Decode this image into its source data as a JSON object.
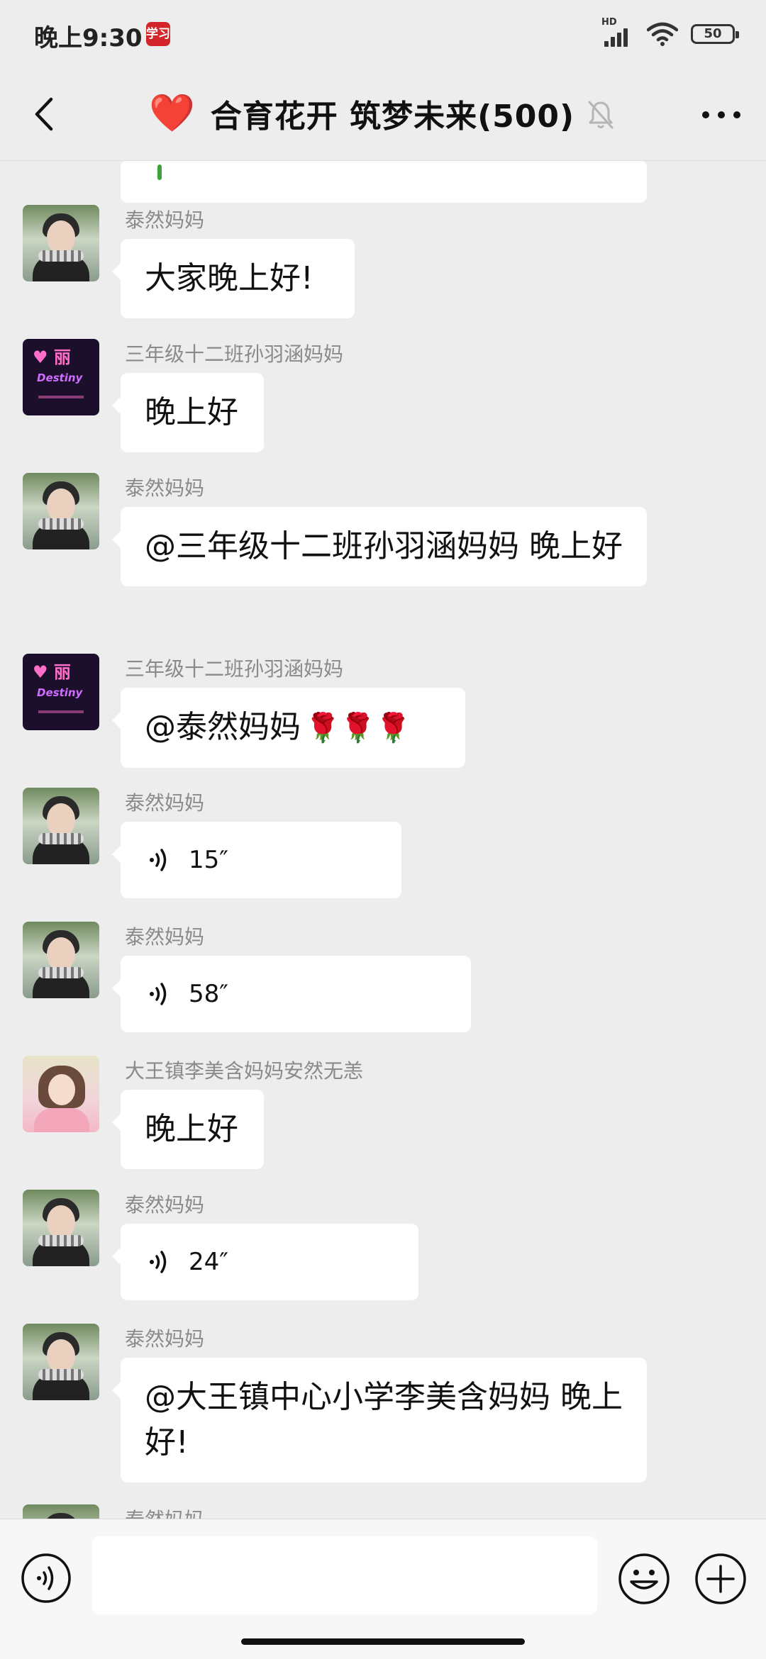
{
  "status_bar": {
    "time": "晚上9:30",
    "app_badge": "学习",
    "network": "HD",
    "battery": "50"
  },
  "header": {
    "title": "合育花开 筑梦未来(500)",
    "emoji": "❤️"
  },
  "messages": [
    {
      "sender": "泰然妈妈",
      "type": "text",
      "text": "大家晚上好!"
    },
    {
      "sender": "三年级十二班孙羽涵妈妈",
      "type": "text",
      "text": "晚上好"
    },
    {
      "sender": "泰然妈妈",
      "type": "text",
      "text": "@三年级十二班孙羽涵妈妈  晚上好"
    },
    {
      "sender": "三年级十二班孙羽涵妈妈",
      "type": "text",
      "text": "@泰然妈妈",
      "emoji": "🌹🌹🌹"
    },
    {
      "sender": "泰然妈妈",
      "type": "voice",
      "duration": "15″"
    },
    {
      "sender": "泰然妈妈",
      "type": "voice",
      "duration": "58″"
    },
    {
      "sender": "大王镇李美含妈妈安然无恙",
      "type": "text",
      "text": "晚上好"
    },
    {
      "sender": "泰然妈妈",
      "type": "voice",
      "duration": "24″"
    },
    {
      "sender": "泰然妈妈",
      "type": "text",
      "text": "@大王镇中心小学李美含妈妈  晚上好!"
    },
    {
      "sender": "泰然妈妈",
      "type": "text",
      "text": ""
    }
  ],
  "input": {
    "value": ""
  },
  "icons": {
    "back": "chevron-left-icon",
    "mute": "bell-off-icon",
    "more": "more-dots-icon",
    "voice": "voice-input-icon",
    "emoji": "emoji-icon",
    "plus": "plus-icon"
  }
}
